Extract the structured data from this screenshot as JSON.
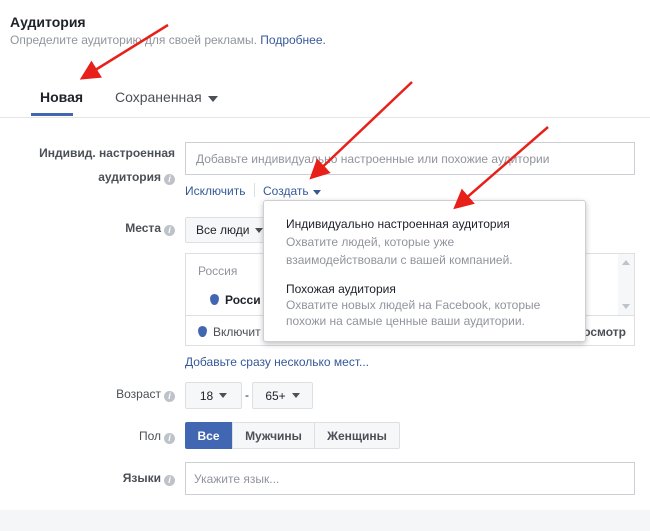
{
  "header": {
    "title": "Аудитория",
    "subtitle": "Определите аудиторию для своей рекламы.",
    "learn_more": "Подробнее."
  },
  "tabs": [
    {
      "label": "Новая",
      "active": true
    },
    {
      "label": "Сохраненная"
    }
  ],
  "custom_audience": {
    "label_line1": "Индивид. настроенная",
    "label_line2": "аудитория",
    "placeholder": "Добавьте индивидуально настроенные или похожие аудитории",
    "exclude": "Исключить",
    "create": "Создать"
  },
  "create_menu": [
    {
      "title": "Индивидуально настроенная аудитория",
      "desc1": "Охватите людей, которые уже",
      "desc2": "взаимодействовали с вашей компанией."
    },
    {
      "title": "Похожая аудитория",
      "desc1": "Охватите новых людей на Facebook, которые",
      "desc2": "похожи на самые ценные ваши аудитории."
    }
  ],
  "locations": {
    "label": "Места",
    "people_select": "Все люди",
    "group": "Россия",
    "item": "Росси",
    "include": "Включит",
    "browse": "осмотр",
    "add_many": "Добавьте сразу несколько мест..."
  },
  "age": {
    "label": "Возраст",
    "min": "18",
    "sep": "-",
    "max": "65+"
  },
  "gender": {
    "label": "Пол",
    "options": [
      "Все",
      "Мужчины",
      "Женщины"
    ],
    "selected": "Все"
  },
  "languages": {
    "label": "Языки",
    "placeholder": "Укажите язык..."
  },
  "colors": {
    "accent": "#4267b2",
    "link": "#365899",
    "arrow": "#e8201a"
  }
}
